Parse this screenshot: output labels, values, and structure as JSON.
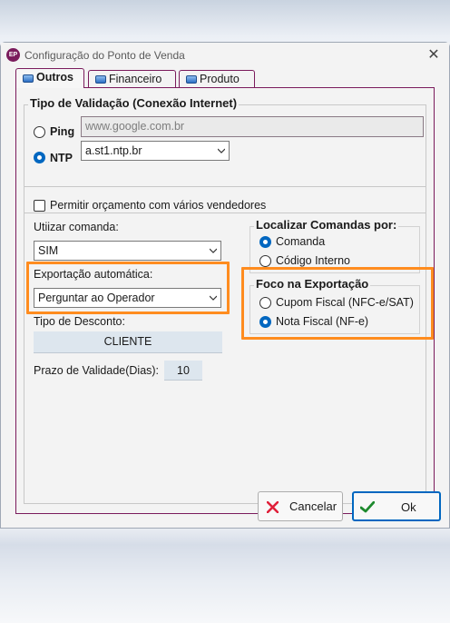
{
  "window": {
    "title": "Configuração do Ponto de Venda",
    "icon_text": "EP",
    "close_glyph": "✕"
  },
  "tabs": [
    {
      "label": "Outros",
      "active": true,
      "icon": "folder-icon"
    },
    {
      "label": "Financeiro",
      "active": false,
      "icon": "folder-icon"
    },
    {
      "label": "Produto",
      "active": false,
      "icon": "folder-icon"
    }
  ],
  "validation": {
    "title": "Tipo de Validação (Conexão Internet)",
    "ping_label": "Ping",
    "ping_value": "www.google.com.br",
    "ntp_label": "NTP",
    "ntp_value": "a.st1.ntp.br",
    "selected": "NTP"
  },
  "options": {
    "multi_seller_label": "Permitir orçamento com vários vendedores",
    "multi_seller_checked": false,
    "comanda_label": "Utiizar comanda:",
    "comanda_value": "SIM",
    "export_label": "Exportação automática:",
    "export_value": "Perguntar ao Operador",
    "discount_label": "Tipo de Desconto:",
    "discount_value": "CLIENTE",
    "validity_label": "Prazo de Validade(Dias):",
    "validity_value": "10"
  },
  "locate": {
    "title": "Localizar Comandas por:",
    "options": [
      "Comanda",
      "Código Interno"
    ],
    "selected": "Comanda"
  },
  "focus": {
    "title": "Foco na Exportação",
    "options": [
      "Cupom Fiscal (NFC-e/SAT)",
      "Nota Fiscal (NF-e)"
    ],
    "selected": "Nota Fiscal (NF-e)"
  },
  "buttons": {
    "cancel": "Cancelar",
    "ok": "Ok"
  },
  "colors": {
    "highlight": "#ff8c1f",
    "accent": "#0067c0",
    "tab_border": "#7a1b5c"
  }
}
